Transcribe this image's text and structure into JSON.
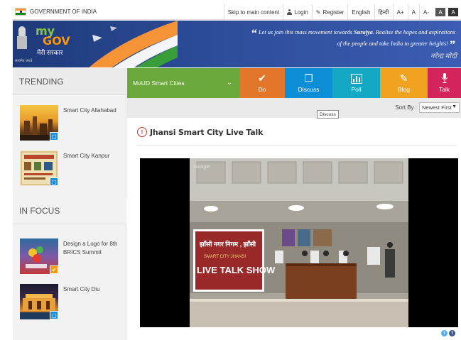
{
  "topbar": {
    "gov_title": "GOVERNMENT OF INDIA",
    "skip_link": "Skip to main content",
    "login": "Login",
    "register": "Register",
    "lang_english": "English",
    "lang_hindi": "हिन्दी",
    "font_increase": "A+",
    "font_normal": "A",
    "font_decrease": "A-",
    "contrast_dark": "A",
    "contrast_light": "A"
  },
  "banner": {
    "logo_my": "my",
    "logo_gov": "GOV",
    "logo_hindi": "मेरी सरकार",
    "quote_pre": "Let us join this mass movement towards ",
    "quote_bold": "Surajya",
    "quote_post": ". Realise the hopes and aspirations of the people and take India to greater heights!",
    "signature": "नरेन्द्र मोदी",
    "emblem_text": "सत्यमेव जयते"
  },
  "sidebar": {
    "trending_title": "TRENDING",
    "infocus_title": "IN FOCUS",
    "trending": [
      {
        "title": "Smart City Allahabad",
        "badge_icon": "discuss-icon"
      },
      {
        "title": "Smart City Kanpur",
        "badge_icon": "discuss-icon"
      }
    ],
    "infocus": [
      {
        "title": "Design a Logo for 8th BRICS Summit",
        "badge_icon": "check-icon"
      },
      {
        "title": "Smart City Diu",
        "badge_icon": "discuss-icon"
      }
    ]
  },
  "main": {
    "group_select": "MoUD Smart Cities",
    "tabs": [
      {
        "label": "Do",
        "icon": "check-icon",
        "color": "#e2762b"
      },
      {
        "label": "Discuss",
        "icon": "discuss-icon",
        "color": "#0d8ed6"
      },
      {
        "label": "Poll",
        "icon": "poll-icon",
        "color": "#14a8c4"
      },
      {
        "label": "Blog",
        "icon": "pencil-icon",
        "color": "#f0a221"
      },
      {
        "label": "Talk",
        "icon": "mic-icon",
        "color": "#d4245c"
      }
    ],
    "tooltip": "Discuss",
    "sort_label": "Sort By :",
    "sort_value": "Newest First",
    "topic_title": "Jhansi Smart City Live Talk",
    "video_watermark": "Google",
    "banner_text_1": "झाँसी नगर निगम , झाँसी",
    "banner_text_2": "SMART CITY JHANSI",
    "banner_text_3": "LIVE TALK SHOW"
  },
  "colors": {
    "brand_green": "#6aa83b",
    "banner_blue": "#2d4c99",
    "do": "#e2762b",
    "discuss": "#0d8ed6",
    "poll": "#14a8c4",
    "blog": "#f0a221",
    "talk": "#d4245c"
  }
}
